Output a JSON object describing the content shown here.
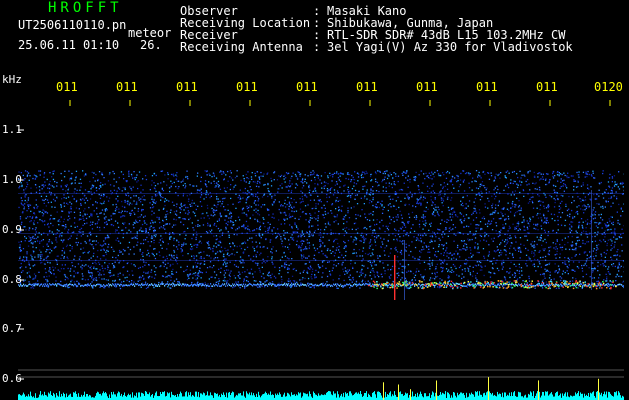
{
  "header": {
    "brand": "HROFFT",
    "filename": "UT2506110110.pn",
    "type_word": "meteor",
    "datetime": "25.06.11 01:10",
    "count": "26."
  },
  "info": {
    "observer_label": "Observer",
    "observer": "Masaki Kano",
    "location_label": "Receiving Location",
    "location": "Shibukawa, Gunma, Japan",
    "receiver_label": "Receiver",
    "receiver": "RTL-SDR SDR# 43dB L15 103.2MHz CW",
    "antenna_label": "Receiving Antenna",
    "antenna": "3el Yagi(V) Az 330 for Vladivostok",
    "separator": ":"
  },
  "y_axis": {
    "unit": "kHz",
    "ticks": [
      "1.1",
      "1.0",
      "0.9",
      "0.8",
      "0.7",
      "0.6"
    ]
  },
  "time_axis": {
    "ticks": [
      "011",
      "011",
      "011",
      "011",
      "011",
      "011",
      "011",
      "011",
      "011",
      "0120"
    ]
  },
  "colors": {
    "background": "#000000",
    "text_white": "#ffffff",
    "text_yellow": "#ffff00",
    "brand_green": "#00ff00",
    "spectrogram_noise": "#1a2fd6",
    "echo_trace": "#ff3030",
    "baseline": "#00ffff"
  }
}
